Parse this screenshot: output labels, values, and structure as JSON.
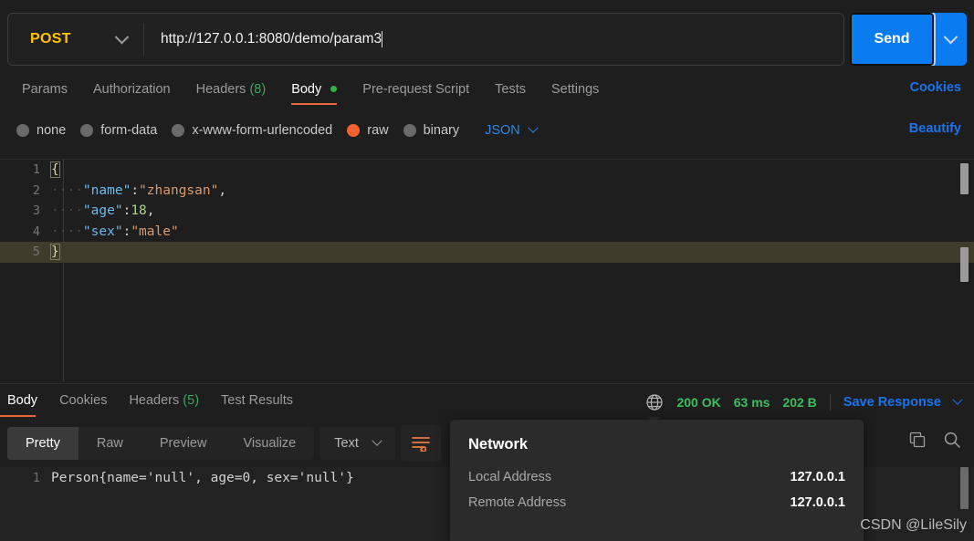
{
  "request": {
    "method": "POST",
    "method_caret_icon": "chevron-down-icon",
    "url": "http://127.0.0.1:8080/demo/param3",
    "url_placeholder": "Enter URL or paste text",
    "send_label": "Send",
    "send_caret_icon": "chevron-down-icon",
    "accent_blue": "#0a7cf0",
    "method_color": "#ffc300"
  },
  "request_tabs": {
    "items": [
      {
        "label": "Params",
        "count": "",
        "active": false
      },
      {
        "label": "Authorization",
        "count": "",
        "active": false
      },
      {
        "label": "Headers",
        "count": "(8)",
        "active": false
      },
      {
        "label": "Body",
        "count": "",
        "active": true,
        "dot": true
      },
      {
        "label": "Pre-request Script",
        "count": "",
        "active": false
      },
      {
        "label": "Tests",
        "count": "",
        "active": false
      },
      {
        "label": "Settings",
        "count": "",
        "active": false
      }
    ],
    "cookies_label": "Cookies",
    "active_underline_color": "#e8663a",
    "count_color": "#3aa55c"
  },
  "body_type": {
    "options": [
      {
        "label": "none",
        "selected": false
      },
      {
        "label": "form-data",
        "selected": false
      },
      {
        "label": "x-www-form-urlencoded",
        "selected": false
      },
      {
        "label": "raw",
        "selected": true
      },
      {
        "label": "binary",
        "selected": false
      }
    ],
    "format_label": "JSON",
    "format_caret_icon": "chevron-down-icon",
    "beautify_label": "Beautify",
    "selected_color": "#f2622f"
  },
  "editor": {
    "lines": [
      {
        "num": "1",
        "indent": "",
        "brace": "{",
        "content": "",
        "active": false
      },
      {
        "num": "2",
        "indent": "····",
        "key": "\"name\"",
        "colon": ":",
        "value": "\"zhangsan\"",
        "comma": ",",
        "active": false,
        "value_type": "string"
      },
      {
        "num": "3",
        "indent": "····",
        "key": "\"age\"",
        "colon": ":",
        "value": "18",
        "comma": ",",
        "active": false,
        "value_type": "number"
      },
      {
        "num": "4",
        "indent": "····",
        "key": "\"sex\"",
        "colon": ":",
        "value": "\"male\"",
        "comma": "",
        "active": false,
        "value_type": "string"
      },
      {
        "num": "5",
        "indent": "",
        "brace": "}",
        "content": "",
        "active": true
      }
    ],
    "key_color": "#6fb8e8",
    "string_color": "#d99a6c",
    "number_color": "#a9d389",
    "active_line_bg": "#3d3d2b"
  },
  "response_tabs": {
    "items": [
      {
        "label": "Body",
        "count": "",
        "active": true
      },
      {
        "label": "Cookies",
        "count": "",
        "active": false
      },
      {
        "label": "Headers",
        "count": "(5)",
        "active": false
      },
      {
        "label": "Test Results",
        "count": "",
        "active": false
      }
    ]
  },
  "response_meta": {
    "globe_icon": "globe-icon",
    "status": "200 OK",
    "time": "63 ms",
    "size": "202 B",
    "save_response_label": "Save Response",
    "save_caret_icon": "chevron-down-icon",
    "status_color": "#3dbd5f"
  },
  "response_toolbar": {
    "views": [
      {
        "label": "Pretty",
        "active": true
      },
      {
        "label": "Raw",
        "active": false
      },
      {
        "label": "Preview",
        "active": false
      },
      {
        "label": "Visualize",
        "active": false
      }
    ],
    "type_label": "Text",
    "type_caret_icon": "chevron-down-icon",
    "wrap_icon": "word-wrap-icon",
    "copy_icon": "copy-icon",
    "search_icon": "search-icon",
    "wrap_active_color": "#e8793f"
  },
  "response_body": {
    "line_number": "1",
    "text": "Person{name='null', age=0, sex='null'}"
  },
  "network_tooltip": {
    "title": "Network",
    "rows": [
      {
        "label": "Local Address",
        "value": "127.0.0.1"
      },
      {
        "label": "Remote Address",
        "value": "127.0.0.1"
      }
    ]
  },
  "watermark": {
    "text": "CSDN @LileSily"
  }
}
